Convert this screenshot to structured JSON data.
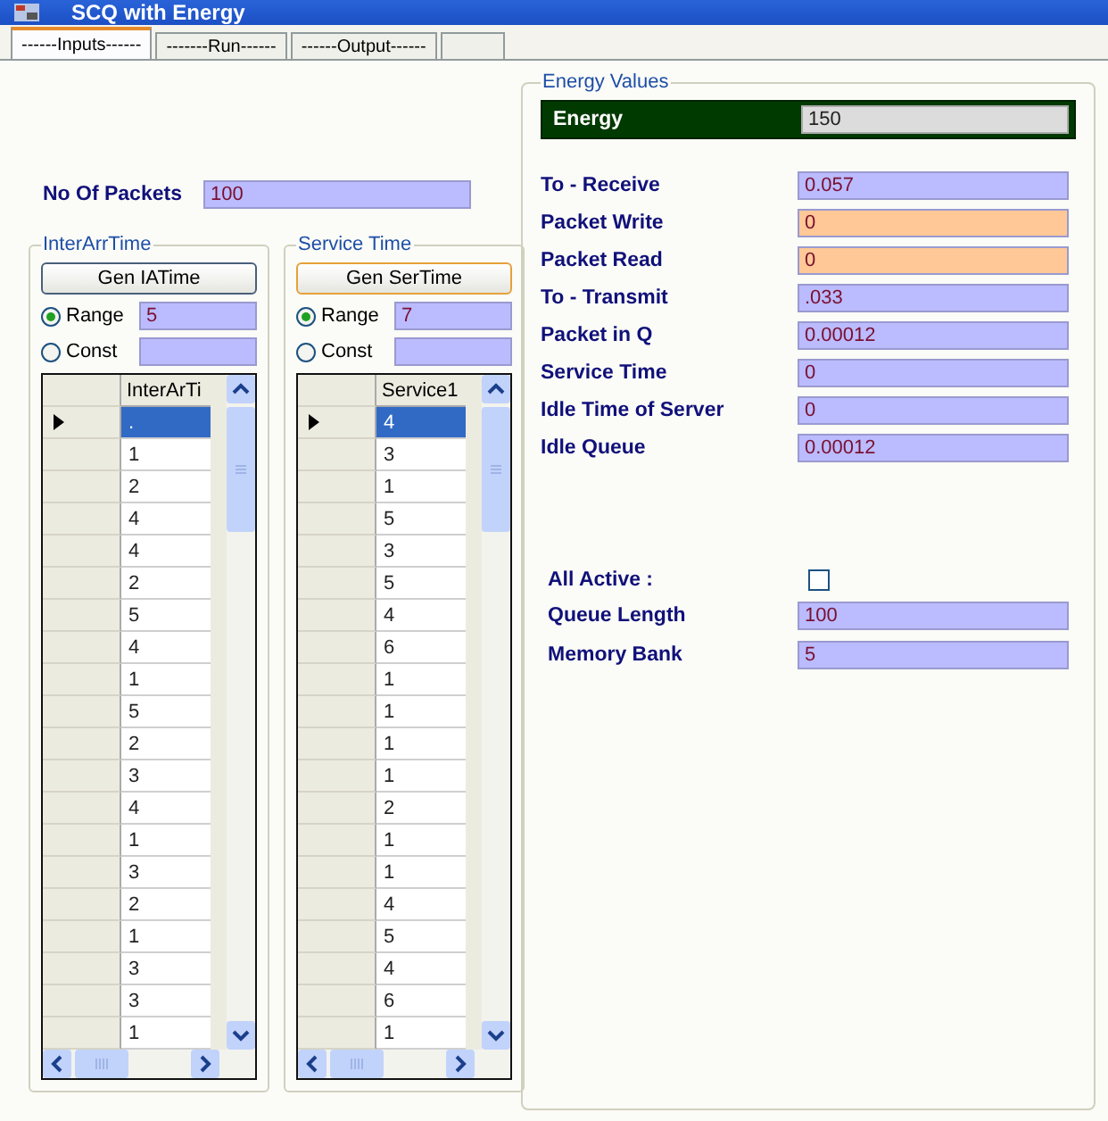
{
  "window": {
    "title": "SCQ with Energy"
  },
  "tabs": [
    {
      "label": "------Inputs------",
      "selected": true
    },
    {
      "label": "-------Run------",
      "selected": false
    },
    {
      "label": "------Output------",
      "selected": false
    }
  ],
  "packets": {
    "label": "No Of Packets",
    "value": "100"
  },
  "groups": [
    {
      "title": "InterArrTime",
      "button": "Gen IATime",
      "options": [
        {
          "label": "Range",
          "selected": true,
          "value": "5"
        },
        {
          "label": "Const",
          "selected": false
        }
      ],
      "grid": {
        "column": "InterArTi",
        "rows": [
          {
            "value": ".",
            "selected": true
          },
          {
            "value": "1",
            "selected": false
          },
          {
            "value": "2",
            "selected": false
          },
          {
            "value": "4",
            "selected": false
          },
          {
            "value": "4",
            "selected": false
          },
          {
            "value": "2",
            "selected": false
          },
          {
            "value": "5",
            "selected": false
          },
          {
            "value": "4",
            "selected": false
          },
          {
            "value": "1",
            "selected": false
          },
          {
            "value": "5",
            "selected": false
          },
          {
            "value": "2",
            "selected": false
          },
          {
            "value": "3",
            "selected": false
          },
          {
            "value": "4",
            "selected": false
          },
          {
            "value": "1",
            "selected": false
          },
          {
            "value": "3",
            "selected": false
          },
          {
            "value": "2",
            "selected": false
          },
          {
            "value": "1",
            "selected": false
          },
          {
            "value": "3",
            "selected": false
          },
          {
            "value": "3",
            "selected": false
          },
          {
            "value": "1",
            "selected": false
          }
        ]
      }
    },
    {
      "title": "Service Time",
      "button": "Gen SerTime",
      "options": [
        {
          "label": "Range",
          "selected": true,
          "value": "7"
        },
        {
          "label": "Const",
          "selected": false
        }
      ],
      "grid": {
        "column": "Service1",
        "rows": [
          {
            "value": "4",
            "selected": true
          },
          {
            "value": "3",
            "selected": false
          },
          {
            "value": "1",
            "selected": false
          },
          {
            "value": "5",
            "selected": false
          },
          {
            "value": "3",
            "selected": false
          },
          {
            "value": "5",
            "selected": false
          },
          {
            "value": "4",
            "selected": false
          },
          {
            "value": "6",
            "selected": false
          },
          {
            "value": "1",
            "selected": false
          },
          {
            "value": "1",
            "selected": false
          },
          {
            "value": "1",
            "selected": false
          },
          {
            "value": "1",
            "selected": false
          },
          {
            "value": "2",
            "selected": false
          },
          {
            "value": "1",
            "selected": false
          },
          {
            "value": "1",
            "selected": false
          },
          {
            "value": "4",
            "selected": false
          },
          {
            "value": "5",
            "selected": false
          },
          {
            "value": "4",
            "selected": false
          },
          {
            "value": "6",
            "selected": false
          },
          {
            "value": "1",
            "selected": false
          }
        ]
      }
    }
  ],
  "energy_values": {
    "title": "Energy Values",
    "energy": {
      "label": "Energy",
      "value": "150"
    },
    "fields": [
      {
        "label": "To - Receive",
        "value": "0.057",
        "color": "#bbbbff"
      },
      {
        "label": "Packet Write",
        "value": "0",
        "color": "#ffc896"
      },
      {
        "label": "Packet Read",
        "value": "0",
        "color": "#ffc896"
      },
      {
        "label": "To - Transmit",
        "value": ".033",
        "color": "#bbbbff"
      },
      {
        "label": "Packet in Q",
        "value": "0.00012",
        "color": "#bbbbff"
      },
      {
        "label": "Service Time",
        "value": "0",
        "color": "#bbbbff"
      },
      {
        "label": "Idle Time of Server",
        "value": "0",
        "color": "#bbbbff"
      },
      {
        "label": "Idle Queue",
        "value": "0.00012",
        "color": "#bbbbff"
      }
    ],
    "all_active": {
      "label": "All Active :",
      "checked": false
    },
    "settings": [
      {
        "label": "Queue Length",
        "value": "100"
      },
      {
        "label": "Memory Bank",
        "value": "5"
      }
    ]
  }
}
